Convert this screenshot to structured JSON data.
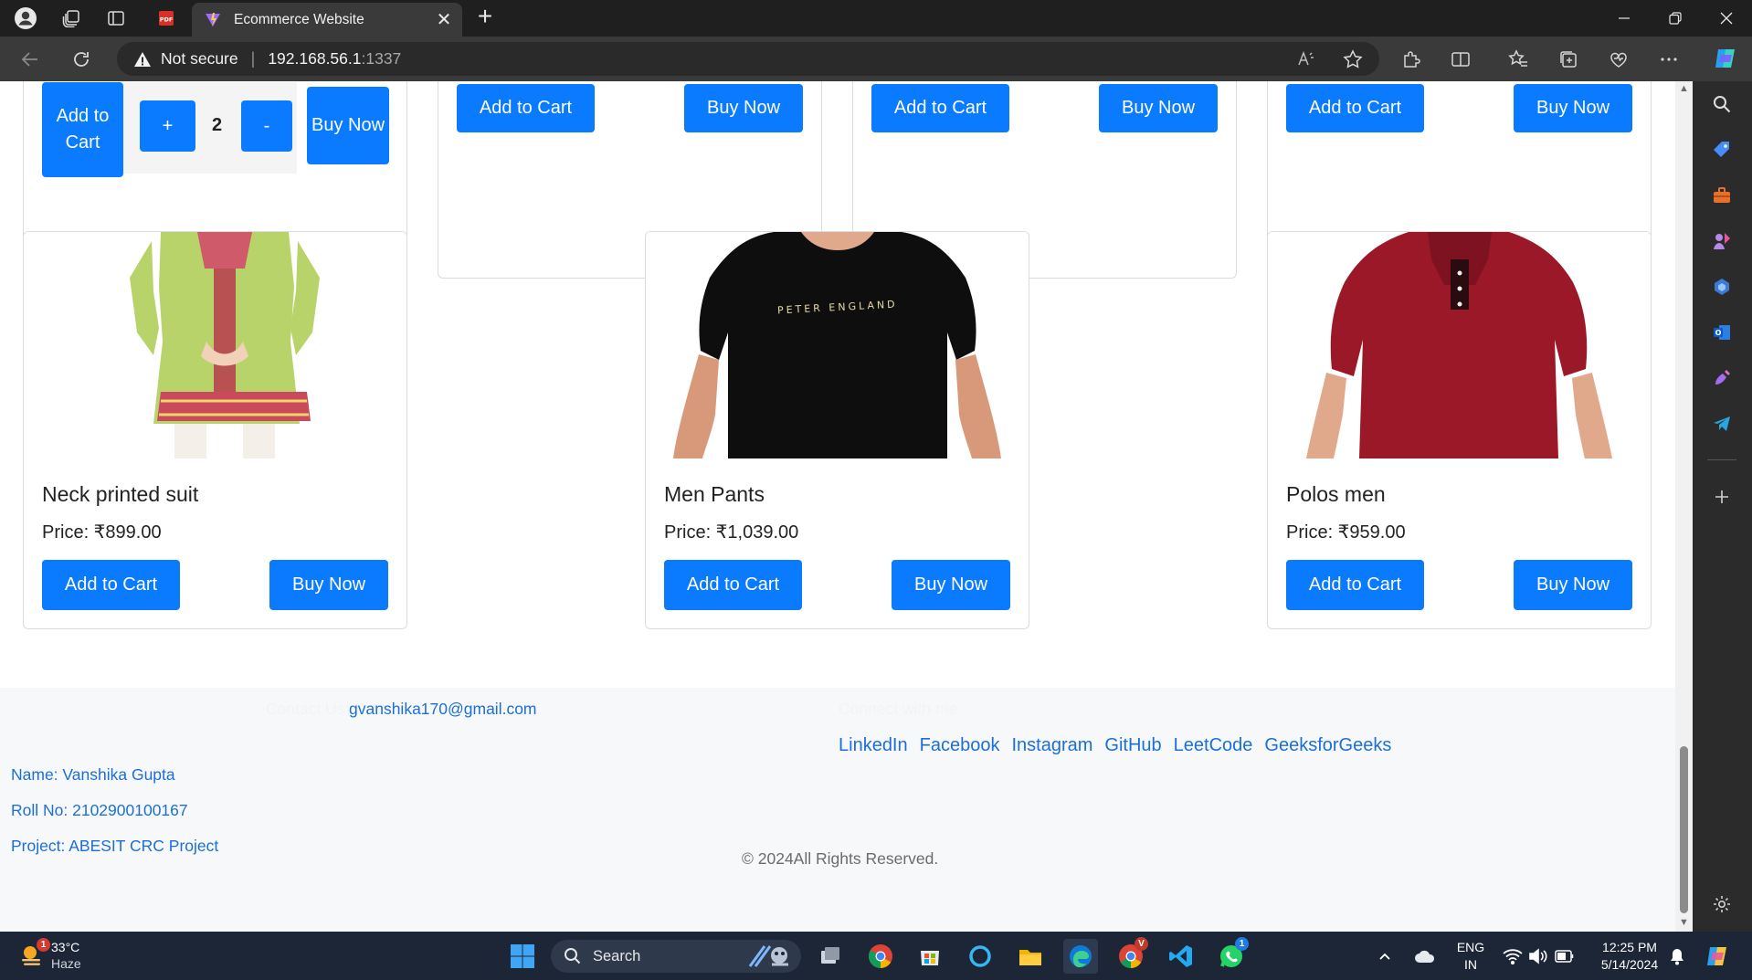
{
  "browser": {
    "tab_title": "Ecommerce Website",
    "address_security": "Not secure",
    "address_host": "192.168.56.1",
    "address_port": ":1337"
  },
  "top_row": {
    "first": {
      "add_label": "Add to Cart",
      "plus_label": "+",
      "quantity": "2",
      "minus_label": "-",
      "buy_label": "Buy Now"
    },
    "cards": [
      {
        "add_label": "Add to Cart",
        "buy_label": "Buy Now"
      },
      {
        "add_label": "Add to Cart",
        "buy_label": "Buy Now"
      },
      {
        "add_label": "Add to Cart",
        "buy_label": "Buy Now"
      }
    ]
  },
  "products": [
    {
      "name": "Neck printed suit",
      "price": "Price: ₹899.00",
      "add_label": "Add to Cart",
      "buy_label": "Buy Now",
      "image": "green-kurta-suit"
    },
    {
      "name": "Men Pants",
      "price": "Price: ₹1,039.00",
      "add_label": "Add to Cart",
      "buy_label": "Buy Now",
      "image": "black-tshirt",
      "shirt_print": "PETER ENGLAND"
    },
    {
      "name": "Polos men",
      "price": "Price: ₹959.00",
      "add_label": "Add to Cart",
      "buy_label": "Buy Now",
      "image": "maroon-polo"
    }
  ],
  "footer": {
    "contact_label": "Contact Us:",
    "email": "gvanshika170@gmail.com",
    "connect_label": "Connect with me:",
    "links": [
      "LinkedIn",
      "Facebook",
      "Instagram",
      "GitHub",
      "LeetCode",
      "GeeksforGeeks"
    ],
    "name": "Name: Vanshika Gupta",
    "roll": "Roll No: 2102900100167",
    "project": "Project: ABESIT CRC Project",
    "copyright": "© 2024All Rights Reserved."
  },
  "taskbar": {
    "temperature": "33°C",
    "condition": "Haze",
    "weather_badge": "1",
    "search_label": "Search",
    "chrome_badge": "V",
    "whatsapp_badge": "1",
    "language_top": "ENG",
    "language_bottom": "IN",
    "time": "12:25 PM",
    "date": "5/14/2024"
  },
  "colors": {
    "primary_button": "#0a7bff",
    "link": "#1b6fd6",
    "taskbar": "#1c2636"
  }
}
